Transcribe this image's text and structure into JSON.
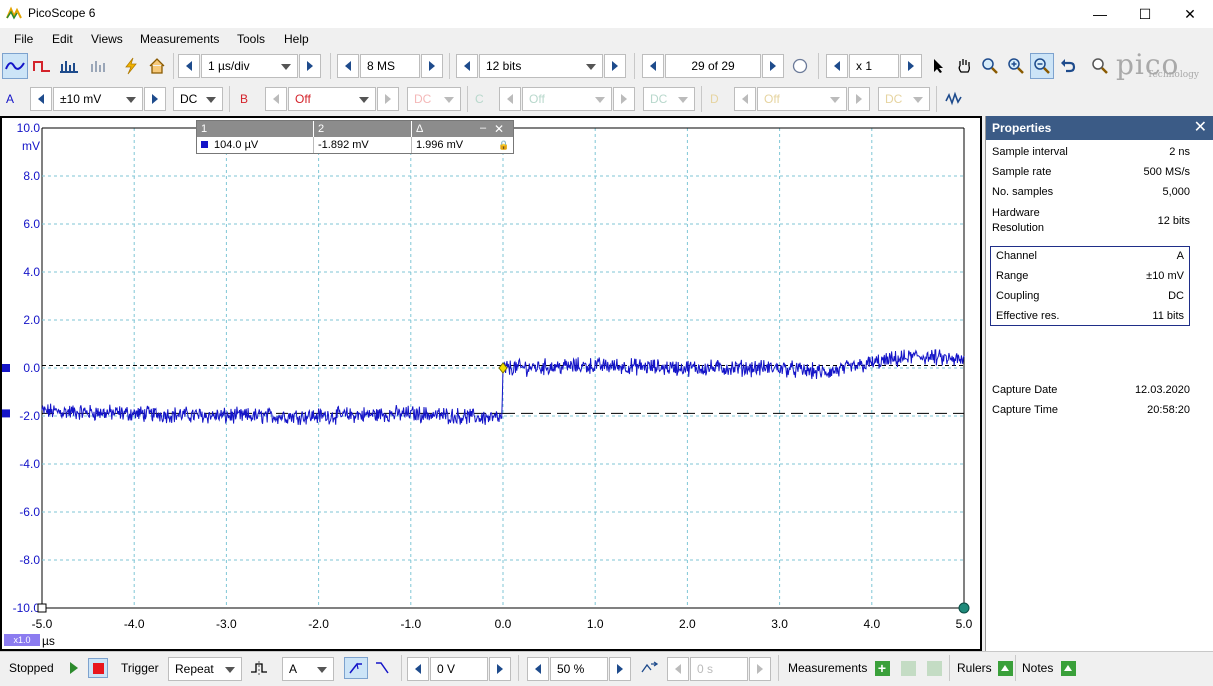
{
  "window": {
    "title": "PicoScope 6",
    "minimize": "—",
    "maximize": "☐",
    "close": "✕"
  },
  "menu": [
    "File",
    "Edit",
    "Views",
    "Measurements",
    "Tools",
    "Help"
  ],
  "toolbar": {
    "timebase": "1 µs/div",
    "samples": "8 MS",
    "resolution": "12 bits",
    "buffer": "29 of 29",
    "zoom": "x 1"
  },
  "channels": {
    "a": {
      "label": "A",
      "range": "±10 mV",
      "coupling": "DC"
    },
    "b": {
      "label": "B",
      "range": "Off",
      "coupling": "DC"
    },
    "c": {
      "label": "C",
      "range": "Off",
      "coupling": "DC"
    },
    "d": {
      "label": "D",
      "range": "Off",
      "coupling": "DC"
    }
  },
  "logo": {
    "text": "pico",
    "sub": "Technology"
  },
  "rulers": {
    "headers": [
      "1",
      "2",
      "Δ"
    ],
    "values": [
      "104.0 µV",
      "-1.892 mV",
      "1.996 mV"
    ]
  },
  "properties": {
    "title": "Properties",
    "rows": [
      {
        "k": "Sample interval",
        "v": "2 ns"
      },
      {
        "k": "Sample rate",
        "v": "500 MS/s"
      },
      {
        "k": "No. samples",
        "v": "5,000"
      },
      {
        "k": "Hardware Resolution",
        "v": "12 bits"
      }
    ],
    "channel_rows": [
      {
        "k": "Channel",
        "v": "A"
      },
      {
        "k": "Range",
        "v": "±10 mV"
      },
      {
        "k": "Coupling",
        "v": "DC"
      },
      {
        "k": "Effective res.",
        "v": "11 bits"
      }
    ],
    "capture_rows": [
      {
        "k": "Capture Date",
        "v": "12.03.2020"
      },
      {
        "k": "Capture Time",
        "v": "20:58:20"
      }
    ]
  },
  "status": {
    "state": "Stopped",
    "trigger_label": "Trigger",
    "trigger_mode": "Repeat",
    "trigger_channel": "A",
    "threshold": "0 V",
    "pretrigger": "50 %",
    "delay": "0 s",
    "measurements": "Measurements",
    "rulers": "Rulers",
    "notes": "Notes"
  },
  "colors": {
    "trace": "#1414c8",
    "accent": "#3b5b86",
    "grid": "#7fc6d6"
  },
  "chart_data": {
    "type": "line",
    "x_unit": "µs",
    "y_unit": "mV",
    "xlim": [
      -5.0,
      5.0
    ],
    "ylim": [
      -10.0,
      10.0
    ],
    "x_ticks": [
      "-5.0",
      "-4.0",
      "-3.0",
      "-2.0",
      "-1.0",
      "0.0",
      "1.0",
      "2.0",
      "3.0",
      "4.0",
      "5.0"
    ],
    "y_ticks": [
      "10.0",
      "8.0",
      "6.0",
      "4.0",
      "2.0",
      "0.0",
      "-2.0",
      "-4.0",
      "-6.0",
      "-8.0",
      "-10.0"
    ],
    "x_scale_badge": "x1.0",
    "grid": true,
    "series": [
      {
        "x": [
          -5.0,
          -4.0,
          -3.0,
          -2.0,
          -1.0,
          -0.01,
          0.0,
          1.0,
          2.0,
          3.0,
          3.5,
          4.0,
          4.5,
          5.0
        ],
        "y": [
          -1.8,
          -1.9,
          -2.0,
          -2.0,
          -1.9,
          -2.1,
          0.0,
          0.1,
          0.0,
          0.0,
          -0.2,
          0.2,
          0.5,
          0.3
        ]
      }
    ],
    "ruler_levels": [
      0.104,
      -1.892
    ]
  }
}
